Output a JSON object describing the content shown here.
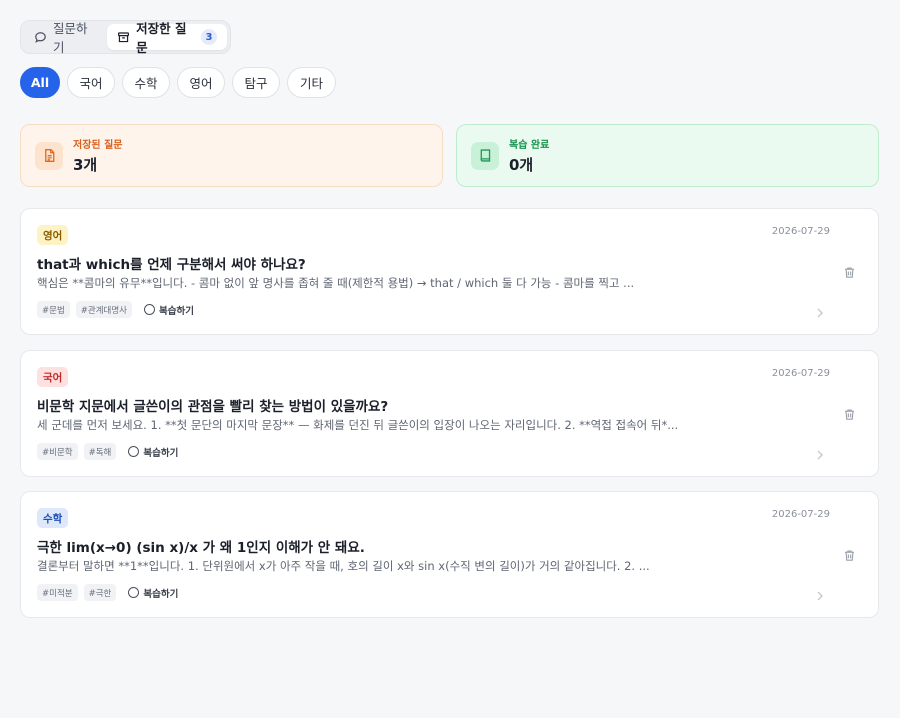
{
  "tabs": {
    "ask_label": "질문하기",
    "saved_label": "저장한 질문",
    "saved_count": "3"
  },
  "filters": [
    "All",
    "국어",
    "수학",
    "영어",
    "탐구",
    "기타"
  ],
  "stats": {
    "saved": {
      "label": "저장된 질문",
      "value": "3개",
      "color": "#d9601d"
    },
    "done": {
      "label": "복습 완료",
      "value": "0개",
      "color": "#17934c"
    }
  },
  "review_label": "복습하기",
  "questions": [
    {
      "subject": "영어",
      "subject_color": "yellow",
      "date": "2026-07-29",
      "title": "that과 which를 언제 구분해서 써야 하나요?",
      "snippet": "핵심은 **콤마의 유무**입니다. - 콤마 없이 앞 명사를 좁혀 줄 때(제한적 용법) → that / which 둘 다 가능 - 콤마를 찍고 ...",
      "tags": [
        "#문법",
        "#관계대명사"
      ]
    },
    {
      "subject": "국어",
      "subject_color": "red",
      "date": "2026-07-29",
      "title": "비문학 지문에서 글쓴이의 관점을 빨리 찾는 방법이 있을까요?",
      "snippet": "세 군데를 먼저 보세요. 1. **첫 문단의 마지막 문장** — 화제를 던진 뒤 글쓴이의 입장이 나오는 자리입니다. 2. **역접 접속어 뒤*...",
      "tags": [
        "#비문학",
        "#독해"
      ]
    },
    {
      "subject": "수학",
      "subject_color": "blue",
      "date": "2026-07-29",
      "title": "극한 lim(x→0) (sin x)/x 가 왜 1인지 이해가 안 돼요.",
      "snippet": "결론부터 말하면 **1**입니다. 1. 단위원에서 x가 아주 작을 때, 호의 길이 x와 sin x(수직 변의 길이)가 거의 같아집니다. 2. ...",
      "tags": [
        "#미적분",
        "#극한"
      ]
    }
  ]
}
